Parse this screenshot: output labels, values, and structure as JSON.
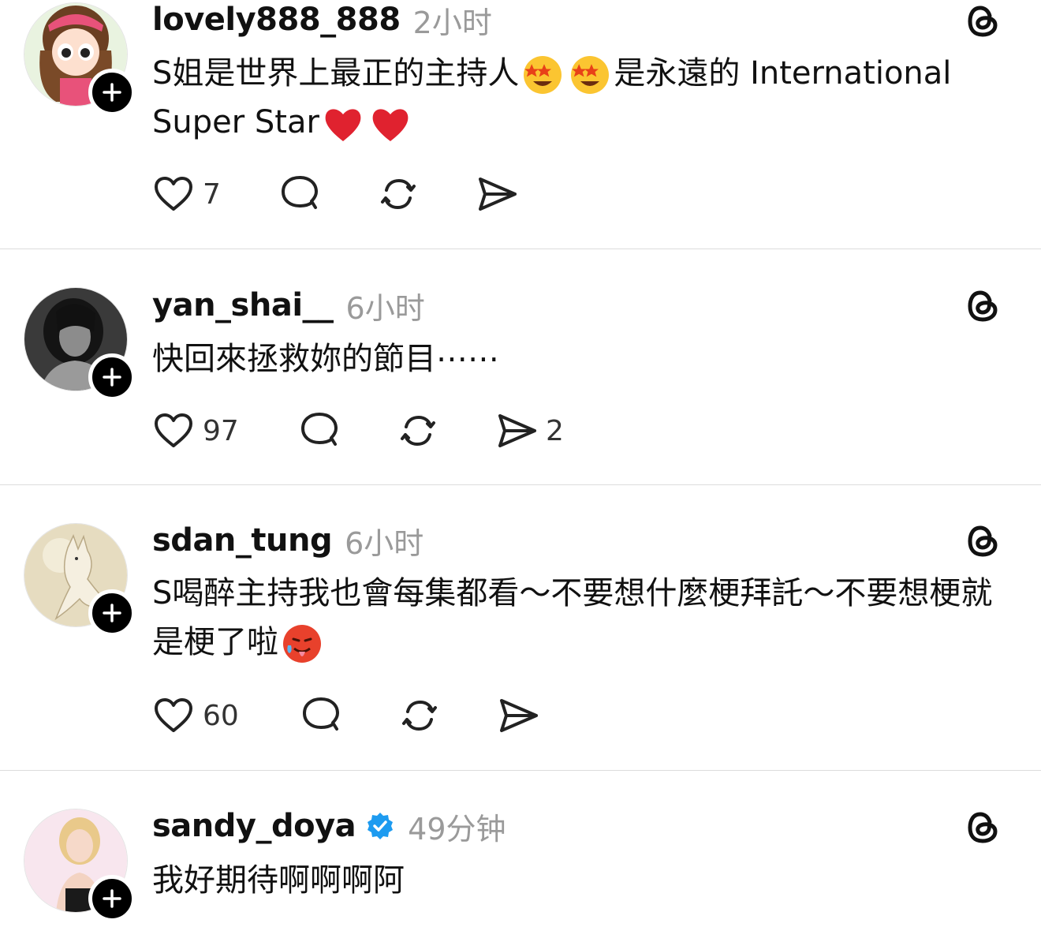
{
  "posts": [
    {
      "username": "lovely888_888",
      "time": "2小时",
      "verified": false,
      "text_parts": [
        "S姐是世界上最正的主持人",
        "是永遠的 International Super Star"
      ],
      "emojis": [
        "star-struck-emoji",
        "star-struck-emoji",
        "red-heart-emoji",
        "red-heart-emoji"
      ],
      "likes": "7",
      "replies": "",
      "reposts": "",
      "shares": ""
    },
    {
      "username": "yan_shai__",
      "time": "6小时",
      "verified": false,
      "text": "快回來拯救妳的節目⋯⋯",
      "likes": "97",
      "replies": "",
      "reposts": "",
      "shares": "2"
    },
    {
      "username": "sdan_tung",
      "time": "6小时",
      "verified": false,
      "text": "S喝醉主持我也會每集都看～不要想什麼梗拜託～不要想梗就是梗了啦",
      "emojis": [
        "hot-face-emoji"
      ],
      "likes": "60",
      "replies": "",
      "reposts": "",
      "shares": ""
    },
    {
      "username": "sandy_doya",
      "time": "49分钟",
      "verified": true,
      "text": "我好期待啊啊啊阿"
    }
  ],
  "icons": {
    "threads": "threads-logo-icon",
    "like": "heart-outline-icon",
    "reply": "speech-bubble-icon",
    "repost": "repost-arrows-icon",
    "share": "paper-plane-icon",
    "follow": "plus-icon",
    "verified": "verified-badge-icon"
  },
  "colors": {
    "verified_badge": "#1d9bf0",
    "time_text": "#9a9a9a",
    "divider": "#dcdcdc"
  }
}
